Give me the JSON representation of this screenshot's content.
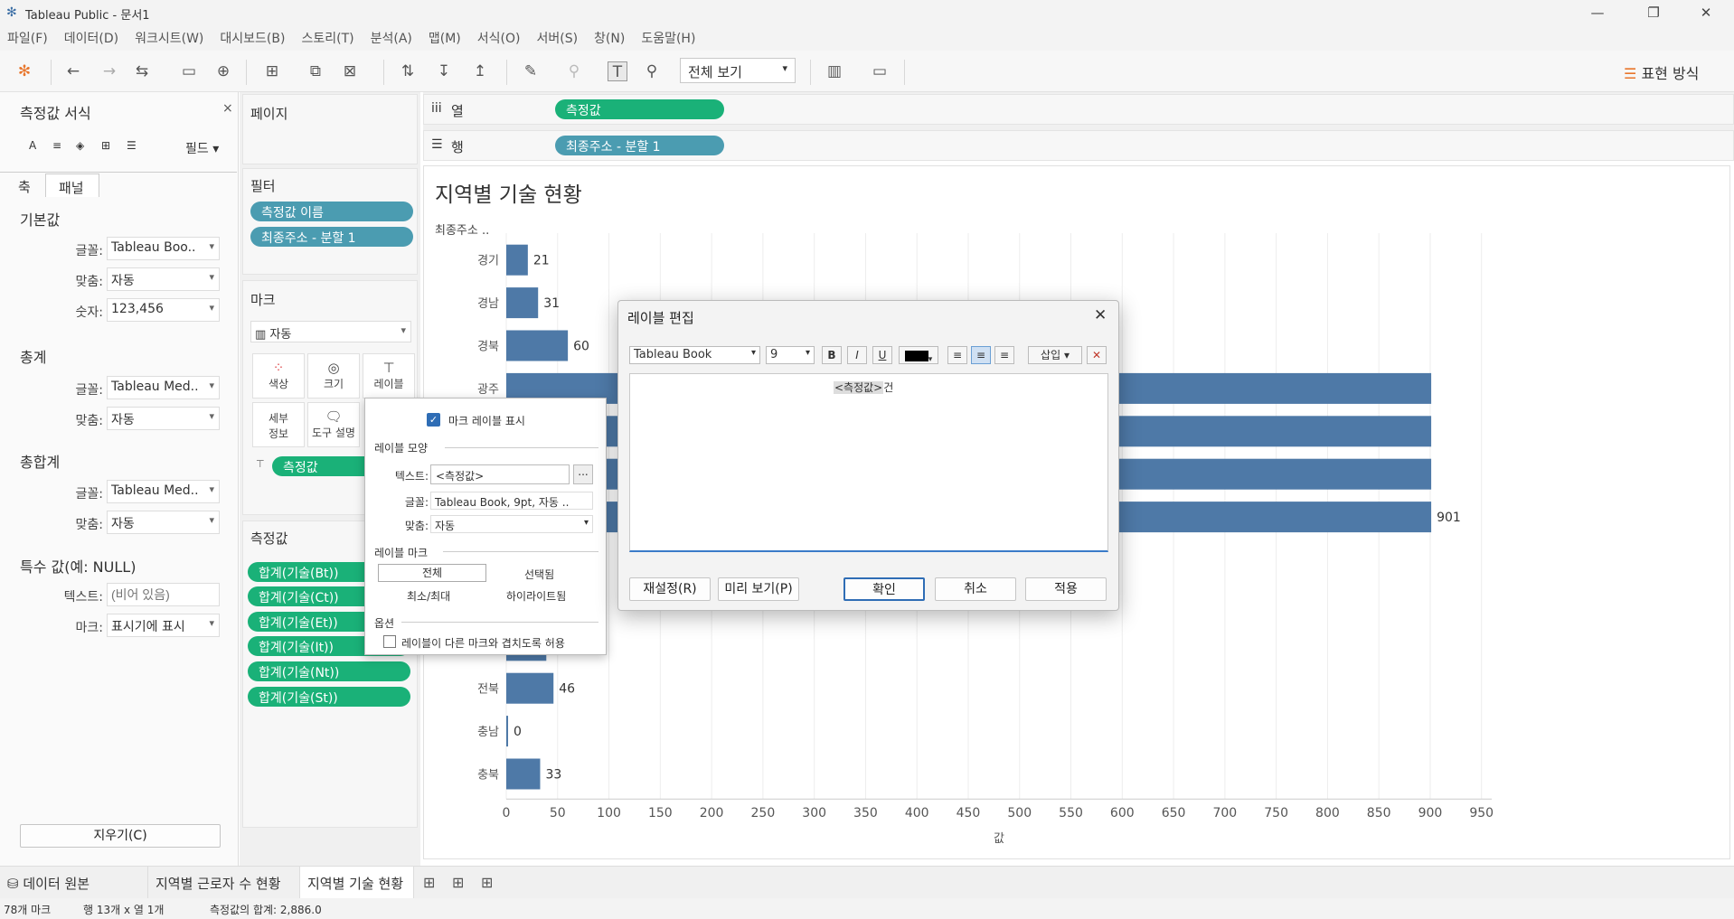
{
  "window": {
    "title": "Tableau Public - 문서1"
  },
  "menu": [
    "파일(F)",
    "데이터(D)",
    "워크시트(W)",
    "대시보드(B)",
    "스토리(T)",
    "분석(A)",
    "맵(M)",
    "서식(O)",
    "서버(S)",
    "창(N)",
    "도움말(H)"
  ],
  "toolbar": {
    "view_select": "전체 보기",
    "show_me": "표현 방식"
  },
  "format_pane": {
    "title": "측정값 서식",
    "field_btn": "필드",
    "tabs": [
      "축",
      "패널"
    ],
    "sections": {
      "default": {
        "title": "기본값",
        "font_label": "글꼴:",
        "font": "Tableau Boo..",
        "align_label": "맞춤:",
        "align": "자동",
        "number_label": "숫자:",
        "number": "123,456"
      },
      "totals": {
        "title": "총계",
        "font_label": "글꼴:",
        "font": "Tableau Med..",
        "align_label": "맞춤:",
        "align": "자동"
      },
      "grand_totals": {
        "title": "총합계",
        "font_label": "글꼴:",
        "font": "Tableau Med..",
        "align_label": "맞춤:",
        "align": "자동"
      },
      "special": {
        "title": "특수 값(예: NULL)",
        "text_label": "텍스트:",
        "text_placeholder": "(비어 있음)",
        "marks_label": "마크:",
        "marks": "표시기에 표시"
      }
    },
    "clear_btn": "지우기(C)"
  },
  "shelves": {
    "pages": "페이지",
    "filters": {
      "title": "필터",
      "pills": [
        "측정값 이름",
        "최종주소 - 분할 1"
      ]
    },
    "marks": {
      "title": "마크",
      "type": "자동",
      "buttons": [
        "색상",
        "크기",
        "레이블",
        "세부\n정보",
        "도구 설명"
      ],
      "pill": "측정값"
    },
    "measures": {
      "title": "측정값",
      "pills": [
        "합계(기술(Bt))",
        "합계(기술(Ct))",
        "합계(기술(Et))",
        "합계(기술(It))",
        "합계(기술(Nt))",
        "합계(기술(St))"
      ]
    },
    "columns": {
      "label": "열",
      "pill": "측정값"
    },
    "rows": {
      "label": "행",
      "pill": "최종주소 - 분할 1"
    }
  },
  "chart_data": {
    "type": "bar",
    "orientation": "horizontal",
    "title": "지역별 기술 현황",
    "row_header": "최종주소 ..",
    "xlabel": "값",
    "xlim": [
      0,
      960
    ],
    "x_ticks": [
      0,
      50,
      100,
      150,
      200,
      250,
      300,
      350,
      400,
      450,
      500,
      550,
      600,
      650,
      700,
      750,
      800,
      850,
      900,
      950
    ],
    "bars": [
      {
        "category": "경기",
        "value": 21,
        "label": "21"
      },
      {
        "category": "경남",
        "value": 31,
        "label": "31"
      },
      {
        "category": "경북",
        "value": 60,
        "label": "60"
      },
      {
        "category": "광주",
        "value": 901,
        "label": ""
      },
      {
        "category": "",
        "value": 901,
        "label": ""
      },
      {
        "category": "",
        "value": 901,
        "label": ""
      },
      {
        "category": "",
        "value": 901,
        "label": "901"
      },
      {
        "category": "",
        "value": 0,
        "label": ""
      },
      {
        "category": "",
        "value": 0,
        "label": ""
      },
      {
        "category": "",
        "value": 39,
        "label": ""
      },
      {
        "category": "전북",
        "value": 46,
        "label": "46"
      },
      {
        "category": "충남",
        "value": 0,
        "label": "0"
      },
      {
        "category": "충북",
        "value": 33,
        "label": "33"
      }
    ],
    "bar_color": "#4e79a7",
    "grid": true
  },
  "label_popup": {
    "show_labels": "마크 레이블 표시",
    "appearance": "레이블 모양",
    "text_label": "텍스트:",
    "text_value": "<측정값>",
    "more": "...",
    "font_label": "글꼴:",
    "font_value": "Tableau Book, 9pt, 자동 ..",
    "align_label": "맞춤:",
    "align_value": "자동",
    "marks_to_label": "레이블 마크",
    "options": [
      "전체",
      "선택됨",
      "최소/최대",
      "하이라이트됨"
    ],
    "options_title": "옵션",
    "overlap": "레이블이 다른 마크와 겹치도록 허용"
  },
  "edit_dialog": {
    "title": "레이블 편집",
    "font": "Tableau Book",
    "size": "9",
    "insert": "삽입",
    "content_field": "<측정값>",
    "content_suffix": "건",
    "reset": "재설정(R)",
    "preview": "미리 보기(P)",
    "ok": "확인",
    "cancel": "취소",
    "apply": "적용"
  },
  "tabs": {
    "datasource": "데이터 원본",
    "sheets": [
      "지역별 근로자 수 현황",
      "지역별 기술 현황"
    ]
  },
  "status": {
    "marks": "78개 마크",
    "rows_cols": "행 13개 x 열 1개",
    "sum": "측정값의 합계: 2,886.0"
  },
  "colors": {
    "pill_green": "#1ab178",
    "pill_blue": "#4b9cb1",
    "bar": "#4e79a7"
  }
}
